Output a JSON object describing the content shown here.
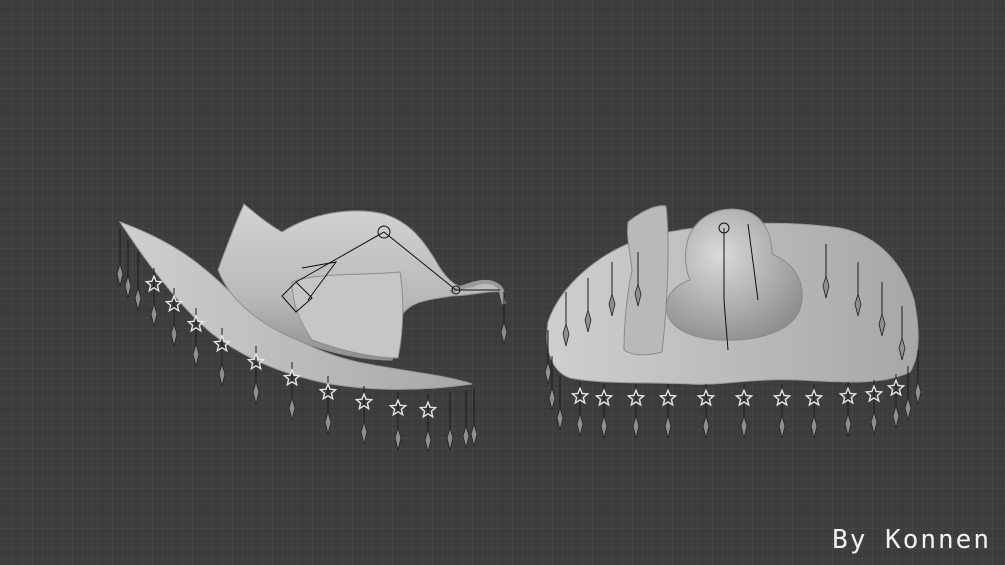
{
  "scene": {
    "background_color": "#3d3d3d",
    "grid": true,
    "model_color": "#bdbdbd",
    "bone_color": "#1a1a1a",
    "ornaments": "star-and-drop",
    "views": [
      "left-hat",
      "right-hat"
    ]
  },
  "credit": "By Konnen"
}
